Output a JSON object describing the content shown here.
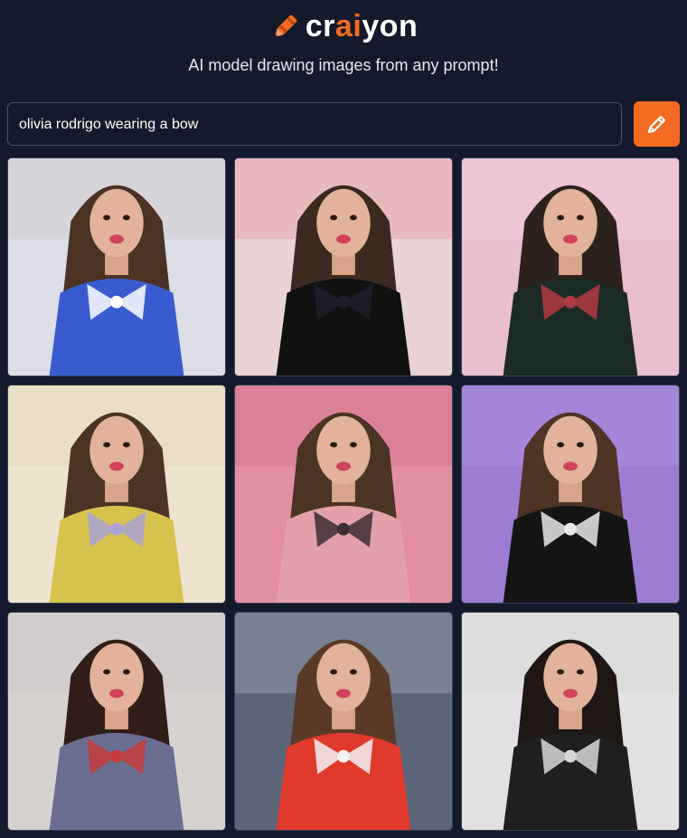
{
  "brand": {
    "name_prefix": "cr",
    "name_accent": "ai",
    "name_suffix": "yon",
    "accent_color": "#f26b20",
    "logo_icon": "crayon-pencil-icon"
  },
  "tagline": "AI model drawing images from any prompt!",
  "search": {
    "value": "olivia rodrigo wearing a bow",
    "button_icon": "pencil-icon"
  },
  "results": {
    "count": 9,
    "tiles": [
      {
        "bg": "#dcdde6",
        "top": "#d6d0d2",
        "hair": "#4a3224",
        "outfit": "#3a5bd0",
        "accent": "#ffffff"
      },
      {
        "bg": "#e8d4d4",
        "top": "#e7a8b1",
        "hair": "#3a2a20",
        "outfit": "#111111",
        "accent": "#1e1e2a"
      },
      {
        "bg": "#e9bfd0",
        "top": "#f0c9d9",
        "hair": "#2b221c",
        "outfit": "#1b2a24",
        "accent": "#b23a44"
      },
      {
        "bg": "#ece4cf",
        "top": "#e8dcc0",
        "hair": "#4a3426",
        "outfit": "#d8c24e",
        "accent": "#a9a3d6"
      },
      {
        "bg": "#e28fa2",
        "top": "#d67891",
        "hair": "#4a3426",
        "outfit": "#e3a0aa",
        "accent": "#3a2e33"
      },
      {
        "bg": "#9c7dd2",
        "top": "#a98be0",
        "hair": "#4d3426",
        "outfit": "#141414",
        "accent": "#e8e8e8"
      },
      {
        "bg": "#d6d2d0",
        "top": "#cfcaca",
        "hair": "#2f1f18",
        "outfit": "#6a6f92",
        "accent": "#c43b3a"
      },
      {
        "bg": "#5c6577",
        "top": "#8a93a3",
        "hair": "#5a3a26",
        "outfit": "#e03a2c",
        "accent": "#f2f2f2"
      },
      {
        "bg": "#e2e0e3",
        "top": "#dadada",
        "hair": "#1e1714",
        "outfit": "#1f1f1f",
        "accent": "#d8d8d8"
      }
    ]
  }
}
